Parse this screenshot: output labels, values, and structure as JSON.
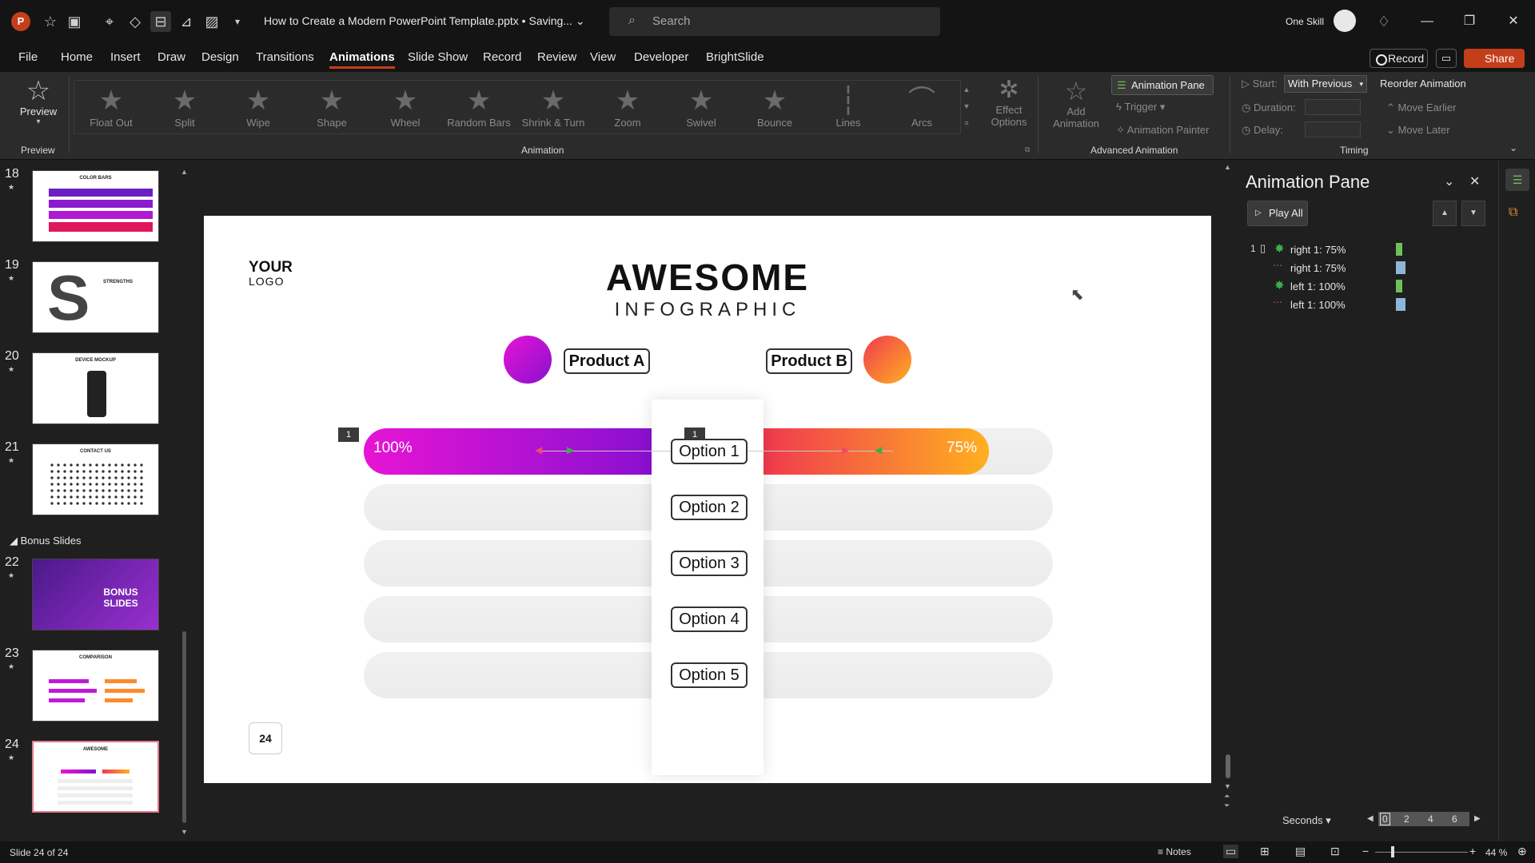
{
  "titlebar": {
    "doc_title": "How to Create a Modern PowerPoint Template.pptx • Saving... ⌄",
    "search_placeholder": "Search",
    "user_name": "One Skill"
  },
  "menu": {
    "tabs": [
      "File",
      "Home",
      "Insert",
      "Draw",
      "Design",
      "Transitions",
      "Animations",
      "Slide Show",
      "Record",
      "Review",
      "View",
      "Developer",
      "BrightSlide"
    ],
    "active": "Animations",
    "record": "Record",
    "share": "Share"
  },
  "ribbon": {
    "preview": "Preview",
    "preview_group": "Preview",
    "animation_group": "Animation",
    "animations": [
      "Float Out",
      "Split",
      "Wipe",
      "Shape",
      "Wheel",
      "Random Bars",
      "Shrink & Turn",
      "Zoom",
      "Swivel",
      "Bounce",
      "Lines",
      "Arcs"
    ],
    "effect_options": [
      "Effect",
      "Options"
    ],
    "add_animation": [
      "Add",
      "Animation"
    ],
    "animation_pane_btn": "Animation Pane",
    "trigger": "Trigger",
    "animation_painter": "Animation Painter",
    "advanced_group": "Advanced Animation",
    "start_label": "Start:",
    "start_value": "With Previous",
    "duration_label": "Duration:",
    "delay_label": "Delay:",
    "reorder": "Reorder Animation",
    "move_earlier": "Move Earlier",
    "move_later": "Move Later",
    "timing_group": "Timing"
  },
  "slides_panel": {
    "slides": [
      {
        "num": "18",
        "title": "COLOR BARS"
      },
      {
        "num": "19",
        "title": "STRENGTHS"
      },
      {
        "num": "20",
        "title": "DEVICE MOCKUP"
      },
      {
        "num": "21",
        "title": "CONTACT US"
      },
      {
        "num": "22",
        "title": "BONUS SLIDES"
      },
      {
        "num": "23",
        "title": "COMPARISON"
      },
      {
        "num": "24",
        "title": "AWESOME"
      }
    ],
    "section": "Bonus Slides"
  },
  "slide": {
    "logo_line1": "YOUR",
    "logo_line2": "LOGO",
    "title": "AWESOME",
    "subtitle": "INFOGRAPHIC",
    "product_a": "Product A",
    "product_b": "Product B",
    "left_value": "100%",
    "right_value": "75%",
    "anim_tag_left": "1",
    "anim_tag_center": "1",
    "options": [
      "Option 1",
      "Option 2",
      "Option 3",
      "Option 4",
      "Option 5"
    ],
    "page_number": "24"
  },
  "animation_pane": {
    "title": "Animation Pane",
    "play_all": "Play All",
    "items": [
      {
        "num": "1",
        "label": "right 1: 75%",
        "bar_color": "#6fbf5a"
      },
      {
        "num": "",
        "label": "right 1: 75%",
        "bar_color": "#8db7d8"
      },
      {
        "num": "",
        "label": "left 1: 100%",
        "bar_color": "#6fbf5a"
      },
      {
        "num": "",
        "label": "left 1: 100%",
        "bar_color": "#8db7d8"
      }
    ],
    "seconds": "Seconds",
    "timeline": [
      "0",
      "2",
      "4",
      "6"
    ]
  },
  "status": {
    "slide_info": "Slide 24 of 24",
    "notes": "Notes",
    "zoom": "44 %"
  },
  "colors": {
    "accent": "#c43e1c",
    "purple": "#b31be0",
    "magenta": "#e714d4",
    "orange": "#ff9a1f",
    "red": "#f03a4f"
  }
}
